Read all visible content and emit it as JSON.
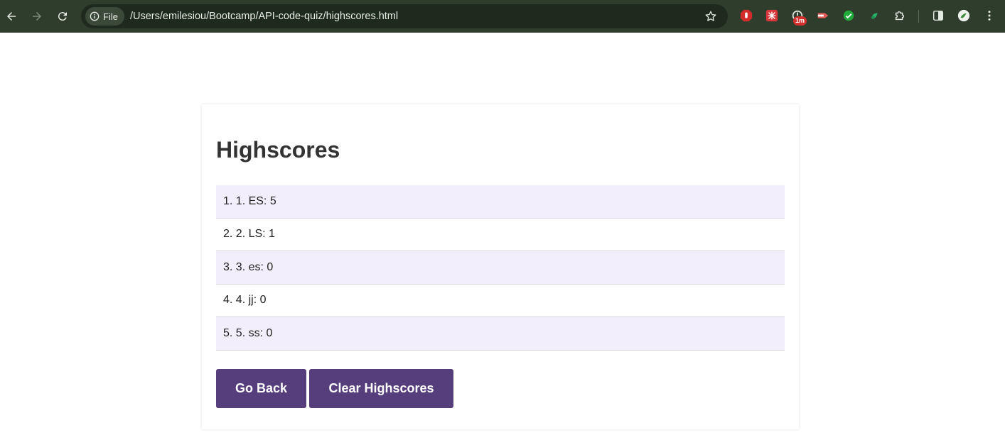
{
  "browser": {
    "file_chip": "File",
    "url": "/Users/emilesiou/Bootcamp/API-code-quiz/highscores.html",
    "extension_badge": "1m",
    "colors": {
      "toolbar": "#2f3e2c",
      "omnibox": "#1f2a1e"
    }
  },
  "page": {
    "title": "Highscores",
    "scores": [
      {
        "text": "1. 1. ES: 5"
      },
      {
        "text": "2. 2. LS: 1"
      },
      {
        "text": "3. 3. es: 0"
      },
      {
        "text": "4. 4. jj: 0"
      },
      {
        "text": "5. 5. ss: 0"
      }
    ],
    "go_back_label": "Go Back",
    "clear_label": "Clear Highscores",
    "colors": {
      "button": "#563d7c",
      "row_highlight": "#f3eefb",
      "title": "#333333"
    }
  }
}
